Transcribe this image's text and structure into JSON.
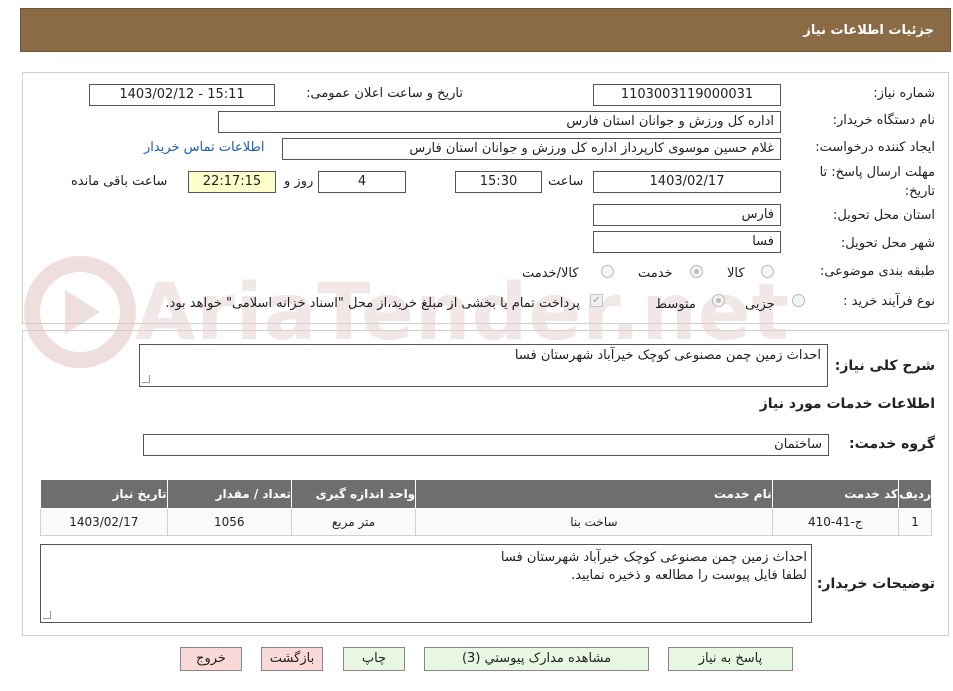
{
  "header": {
    "title": "جزئیات اطلاعات نیاز"
  },
  "watermark": {
    "text": "AriaTender.net"
  },
  "form": {
    "need_number": {
      "label": "شماره نیاز:",
      "value": "1103003119000031"
    },
    "announce": {
      "label": "تاریخ و ساعت اعلان عمومی:",
      "value": "1403/02/12 - 15:11"
    },
    "buyer_org": {
      "label": "نام دستگاه خریدار:",
      "value": "اداره کل ورزش و جوانان استان فارس"
    },
    "requester": {
      "label": "ایجاد کننده درخواست:",
      "value": "غلام حسین موسوی کارپرداز اداره کل ورزش و جوانان استان فارس"
    },
    "contact_link": "اطلاعات تماس خریدار",
    "deadline": {
      "label_line1": "مهلت ارسال پاسخ: تا",
      "label_line2": "تاریخ:",
      "date": "1403/02/17",
      "time_label": "ساعت",
      "time": "15:30",
      "days": "4",
      "days_label": "روز و",
      "remaining": "22:17:15",
      "remaining_label": "ساعت باقی مانده"
    },
    "province": {
      "label": "استان محل تحویل:",
      "value": "فارس"
    },
    "city": {
      "label": "شهر محل تحویل:",
      "value": "فسا"
    },
    "category": {
      "label": "طبقه بندی موضوعی:",
      "options": [
        "کالا",
        "خدمت",
        "کالا/خدمت"
      ],
      "selected": "خدمت"
    },
    "process": {
      "label": "نوع فرآیند خرید :",
      "options": [
        "جزیی",
        "متوسط"
      ],
      "selected": "متوسط",
      "payment_note": "پرداخت تمام یا بخشی از مبلغ خرید،از محل \"اسناد خزانه اسلامی\" خواهد بود."
    }
  },
  "summary": {
    "label": "شرح کلی نیاز:",
    "value": "احداث زمین چمن مصنوعی کوچک خیرآباد شهرستان فسا"
  },
  "services": {
    "section_title": "اطلاعات خدمات مورد نیاز",
    "group_label": "گروه خدمت:",
    "group_value": "ساختمان",
    "columns": [
      "ردیف",
      "کد خدمت",
      "نام خدمت",
      "واحد اندازه گیری",
      "تعداد / مقدار",
      "تاریخ نیاز"
    ],
    "rows": [
      {
        "row": "1",
        "code": "ج-41-410",
        "name": "ساخت بنا",
        "unit": "متر مربع",
        "qty": "1056",
        "date": "1403/02/17"
      }
    ]
  },
  "buyer_notes": {
    "label": "توضیحات خریدار:",
    "line1": "احداث زمین چمن مصنوعی کوچک خیرآباد شهرستان فسا",
    "line2": "لطفا فایل پیوست را مطالعه و ذخیره نمایید."
  },
  "buttons": {
    "reply": "پاسخ به نیاز",
    "attachments": "مشاهده مدارک پیوستي (3)",
    "print": "چاپ",
    "back": "بازگشت",
    "exit": "خروج"
  }
}
